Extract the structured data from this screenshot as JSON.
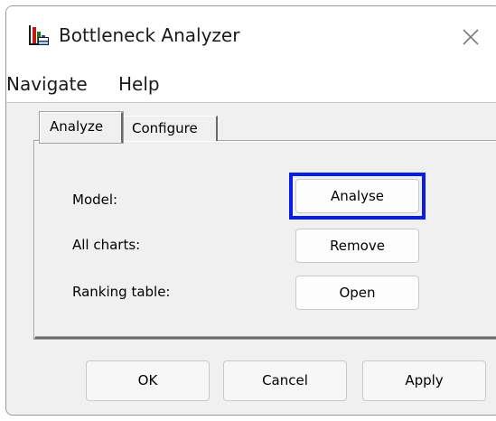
{
  "window": {
    "title": "Bottleneck Analyzer",
    "app_icon": "bar-chart-app-icon",
    "close_icon": "close-icon"
  },
  "menu": {
    "items": [
      {
        "label": "Navigate"
      },
      {
        "label": "Help"
      }
    ]
  },
  "tabs": [
    {
      "label": "Analyze",
      "active": true
    },
    {
      "label": "Configure",
      "active": false
    }
  ],
  "rows": [
    {
      "label": "Model:",
      "button": "Analyse",
      "focused": true
    },
    {
      "label": "All charts:",
      "button": "Remove",
      "focused": false
    },
    {
      "label": "Ranking table:",
      "button": "Open",
      "focused": false
    }
  ],
  "footer": {
    "ok": "OK",
    "cancel": "Cancel",
    "apply": "Apply"
  },
  "colors": {
    "focus_ring": "#0a1de6",
    "window_bg": "#f0f0f0",
    "titlebar_bg": "#ffffff"
  }
}
